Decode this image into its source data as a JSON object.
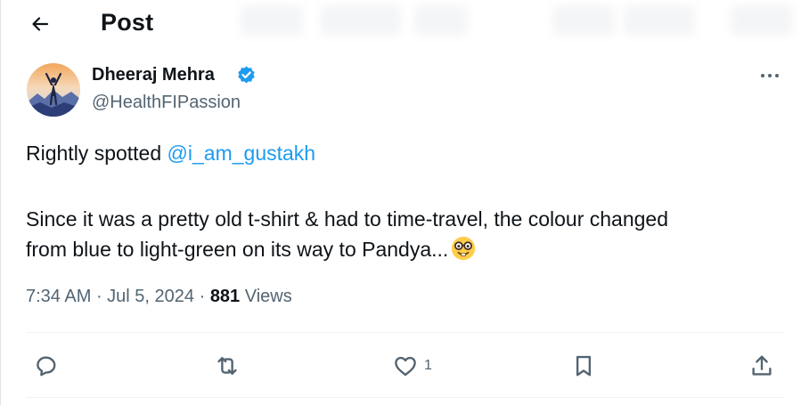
{
  "header": {
    "back_icon": "arrow-left-icon",
    "title": "Post"
  },
  "author": {
    "name": "Dheeraj Mehra",
    "handle": "@HealthFIPassion",
    "verified": true,
    "verified_icon": "verified-badge-icon",
    "avatar_icon": "avatar-image"
  },
  "tweet": {
    "line1_prefix": "Rightly spotted ",
    "mention": "@i_am_gustakh",
    "line2": "Since it was a pretty old t-shirt & had to time-travel, the colour changed",
    "line3": "from blue to light-green on its way to Pandya...",
    "emoji": "nerd-face-emoji"
  },
  "meta": {
    "time": "7:34 AM",
    "separator": " · ",
    "date": "Jul 5, 2024",
    "views_count": "881",
    "views_label": "Views"
  },
  "actions": {
    "reply_icon": "reply-icon",
    "repost_icon": "repost-icon",
    "like_icon": "heart-icon",
    "like_count": "1",
    "bookmark_icon": "bookmark-icon",
    "share_icon": "share-icon",
    "more_icon": "more-dots-icon"
  },
  "colors": {
    "text": "#0f1419",
    "secondary": "#536471",
    "accent": "#1d9bf0",
    "divider": "#eff3f4"
  }
}
